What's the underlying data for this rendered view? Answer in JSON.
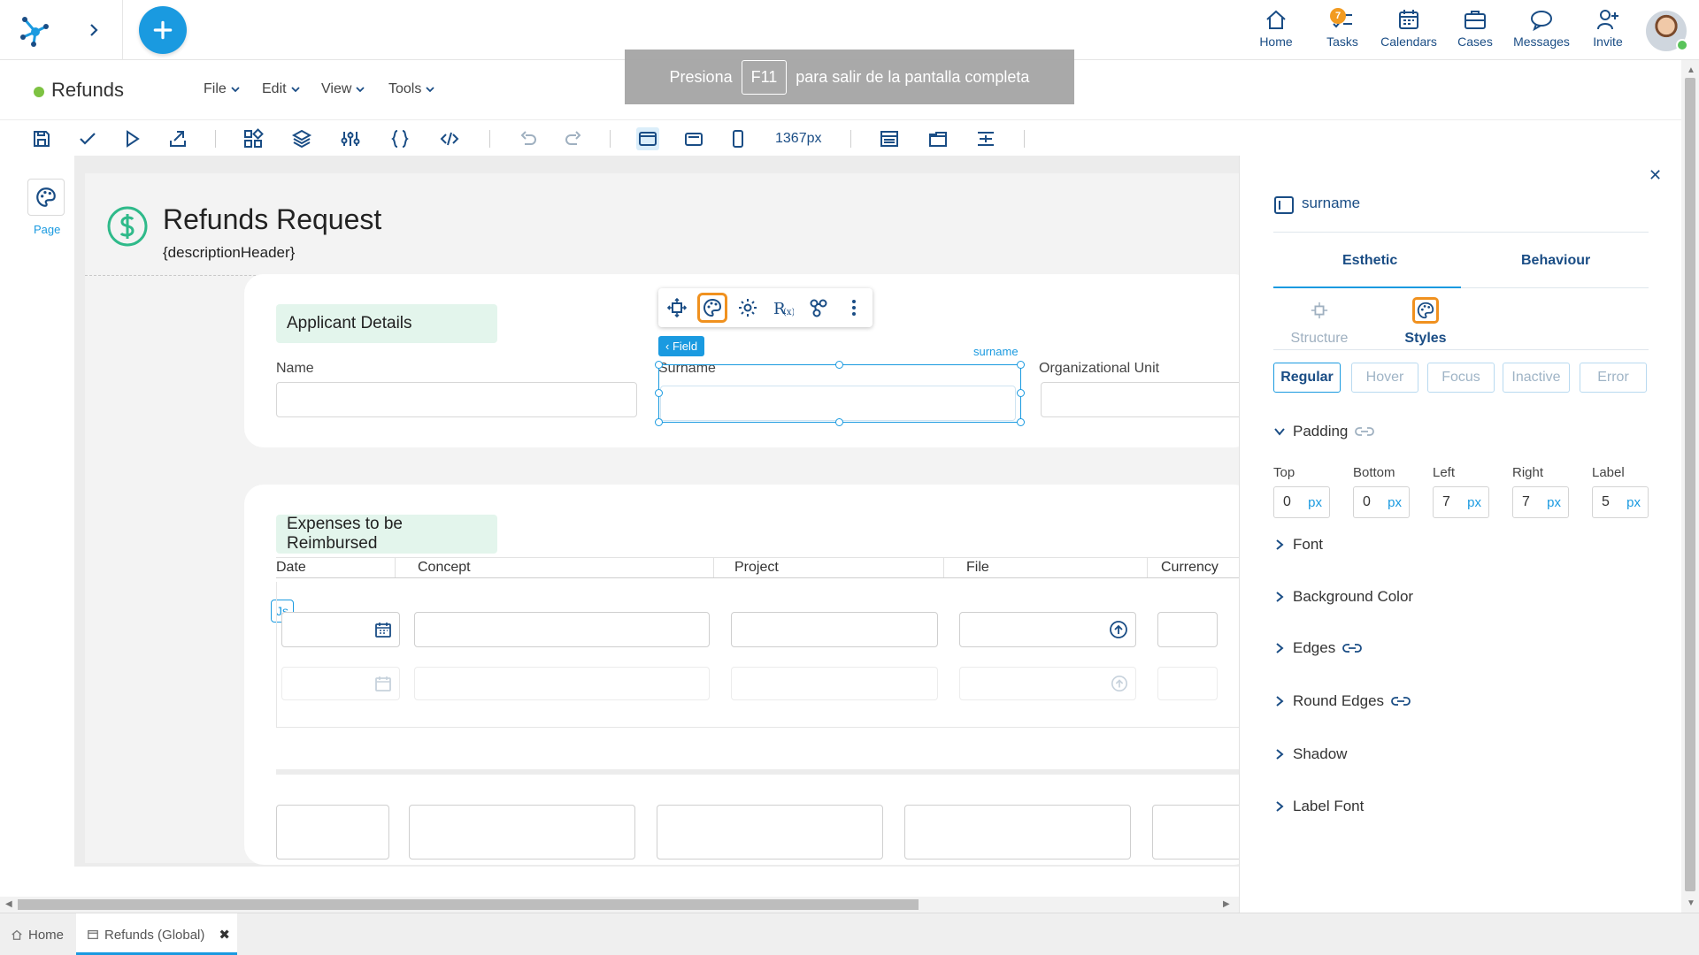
{
  "topbar": {
    "nav": [
      {
        "name": "home",
        "label": "Home",
        "icon": "home-icon"
      },
      {
        "name": "tasks",
        "label": "Tasks",
        "icon": "tasks-icon",
        "badge": "7"
      },
      {
        "name": "calendars",
        "label": "Calendars",
        "icon": "calendar-icon"
      },
      {
        "name": "cases",
        "label": "Cases",
        "icon": "briefcase-icon"
      },
      {
        "name": "messages",
        "label": "Messages",
        "icon": "chat-icon"
      },
      {
        "name": "invite",
        "label": "Invite",
        "icon": "add-user-icon"
      }
    ]
  },
  "app": {
    "title": "Refunds",
    "status_color": "#7dc242",
    "menus": [
      "File",
      "Edit",
      "View",
      "Tools"
    ]
  },
  "fullscreen_banner": {
    "before": "Presiona",
    "key": "F11",
    "after": "para salir de la pantalla completa"
  },
  "toolbar": {
    "width_display": "1367px"
  },
  "leftrail": {
    "page_label": "Page"
  },
  "form": {
    "title": "Refunds Request",
    "subtitle": "{descriptionHeader}",
    "section1": {
      "title": "Applicant Details",
      "fields": [
        "Name",
        "Surname",
        "Organizational Unit"
      ]
    },
    "selected": {
      "tag": "Field",
      "name": "surname"
    },
    "section2": {
      "title": "Expenses to be Reimbursed",
      "columns": [
        "Date",
        "Concept",
        "Project",
        "File",
        "Currency"
      ],
      "js_tag": "Js"
    }
  },
  "panel": {
    "component_name": "surname",
    "tabs": [
      "Esthetic",
      "Behaviour"
    ],
    "subtabs": [
      "Structure",
      "Styles"
    ],
    "states": [
      "Regular",
      "Hover",
      "Focus",
      "Inactive",
      "Error"
    ],
    "padding": {
      "title": "Padding",
      "fields": [
        {
          "label": "Top",
          "value": "0",
          "unit": "px"
        },
        {
          "label": "Bottom",
          "value": "0",
          "unit": "px"
        },
        {
          "label": "Left",
          "value": "7",
          "unit": "px"
        },
        {
          "label": "Right",
          "value": "7",
          "unit": "px"
        },
        {
          "label": "Label",
          "value": "5",
          "unit": "px"
        }
      ]
    },
    "sections": [
      "Font",
      "Background Color",
      "Edges",
      "Round Edges",
      "Shadow",
      "Label Font"
    ]
  },
  "bottom_tabs": [
    {
      "label": "Home"
    },
    {
      "label": "Refunds (Global)"
    }
  ],
  "colors": {
    "accent": "#1a9ae0",
    "brand_dark": "#1a4d85",
    "highlight": "#f0911f",
    "section_bg": "#e3f5ec"
  }
}
